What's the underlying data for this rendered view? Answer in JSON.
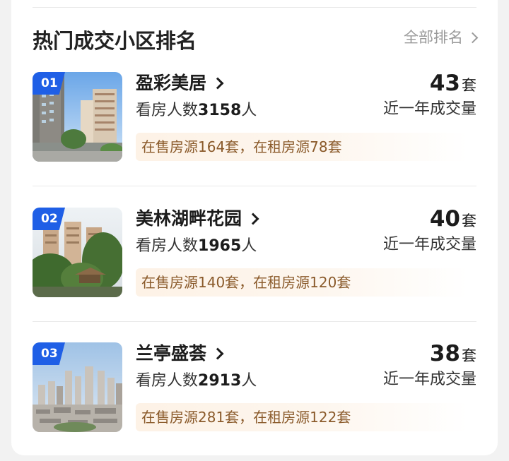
{
  "header": {
    "title": "热门成交小区排名",
    "all_label": "全部排名"
  },
  "items": [
    {
      "rank": "01",
      "name": "盈彩美居",
      "viewers_prefix": "看房人数",
      "viewers": "3158",
      "viewers_suffix": "人",
      "listing": "在售房源164套，在租房源78套",
      "deals": "43",
      "deals_unit": "套",
      "deals_label": "近一年成交量"
    },
    {
      "rank": "02",
      "name": "美林湖畔花园",
      "viewers_prefix": "看房人数",
      "viewers": "1965",
      "viewers_suffix": "人",
      "listing": "在售房源140套，在租房源120套",
      "deals": "40",
      "deals_unit": "套",
      "deals_label": "近一年成交量"
    },
    {
      "rank": "03",
      "name": "兰亭盛荟",
      "viewers_prefix": "看房人数",
      "viewers": "2913",
      "viewers_suffix": "人",
      "listing": "在售房源281套，在租房源122套",
      "deals": "38",
      "deals_unit": "套",
      "deals_label": "近一年成交量"
    }
  ],
  "colors": {
    "rank_badge": "#1f5fe6",
    "listing_text": "#8a5a2a",
    "listing_bg": "#fdf2e6"
  }
}
